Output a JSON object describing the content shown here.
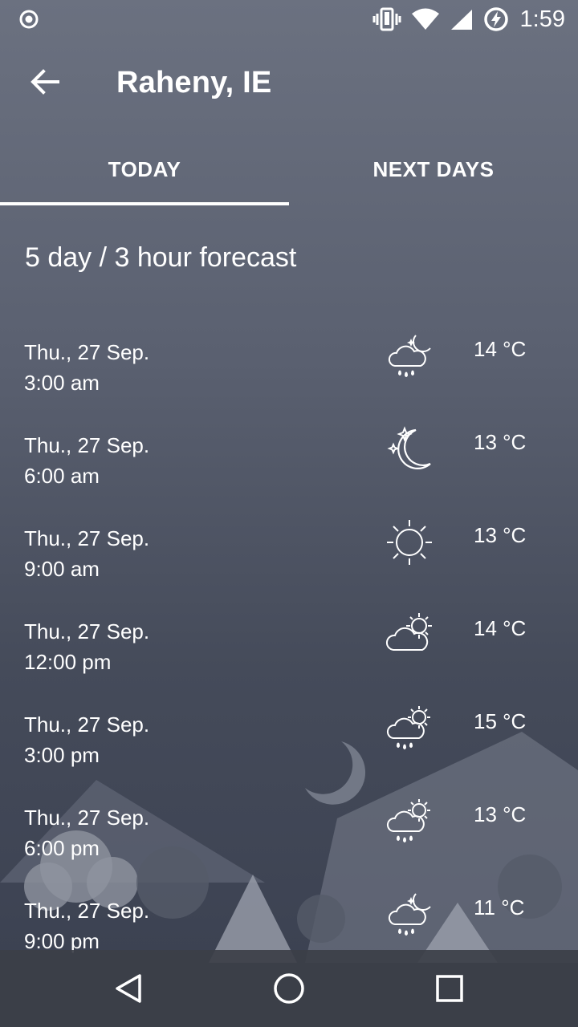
{
  "status_bar": {
    "time": "1:59",
    "icons": [
      "record-icon",
      "vibrate-icon",
      "wifi-icon",
      "signal-icon",
      "battery-charging-icon"
    ]
  },
  "app_bar": {
    "title": "Raheny, IE",
    "back_icon": "arrow-left-icon"
  },
  "tabs": [
    {
      "label": "TODAY",
      "selected": true
    },
    {
      "label": "NEXT DAYS",
      "selected": false
    }
  ],
  "heading": "5 day / 3 hour forecast",
  "forecast": [
    {
      "date": "Thu., 27 Sep.",
      "time": "3:00 am",
      "icon": "night-rain-icon",
      "temp": "14 °C"
    },
    {
      "date": "Thu., 27 Sep.",
      "time": "6:00 am",
      "icon": "clear-night-icon",
      "temp": "13 °C"
    },
    {
      "date": "Thu., 27 Sep.",
      "time": "9:00 am",
      "icon": "sun-icon",
      "temp": "13 °C"
    },
    {
      "date": "Thu., 27 Sep.",
      "time": "12:00 pm",
      "icon": "partly-cloudy-icon",
      "temp": "14 °C"
    },
    {
      "date": "Thu., 27 Sep.",
      "time": "3:00 pm",
      "icon": "day-rain-icon",
      "temp": "15 °C"
    },
    {
      "date": "Thu., 27 Sep.",
      "time": "6:00 pm",
      "icon": "day-rain-icon",
      "temp": "13 °C"
    },
    {
      "date": "Thu., 27 Sep.",
      "time": "9:00 pm",
      "icon": "night-rain-icon",
      "temp": "11 °C"
    }
  ],
  "nav_bar": [
    "back-triangle-icon",
    "home-circle-icon",
    "recents-square-icon"
  ]
}
